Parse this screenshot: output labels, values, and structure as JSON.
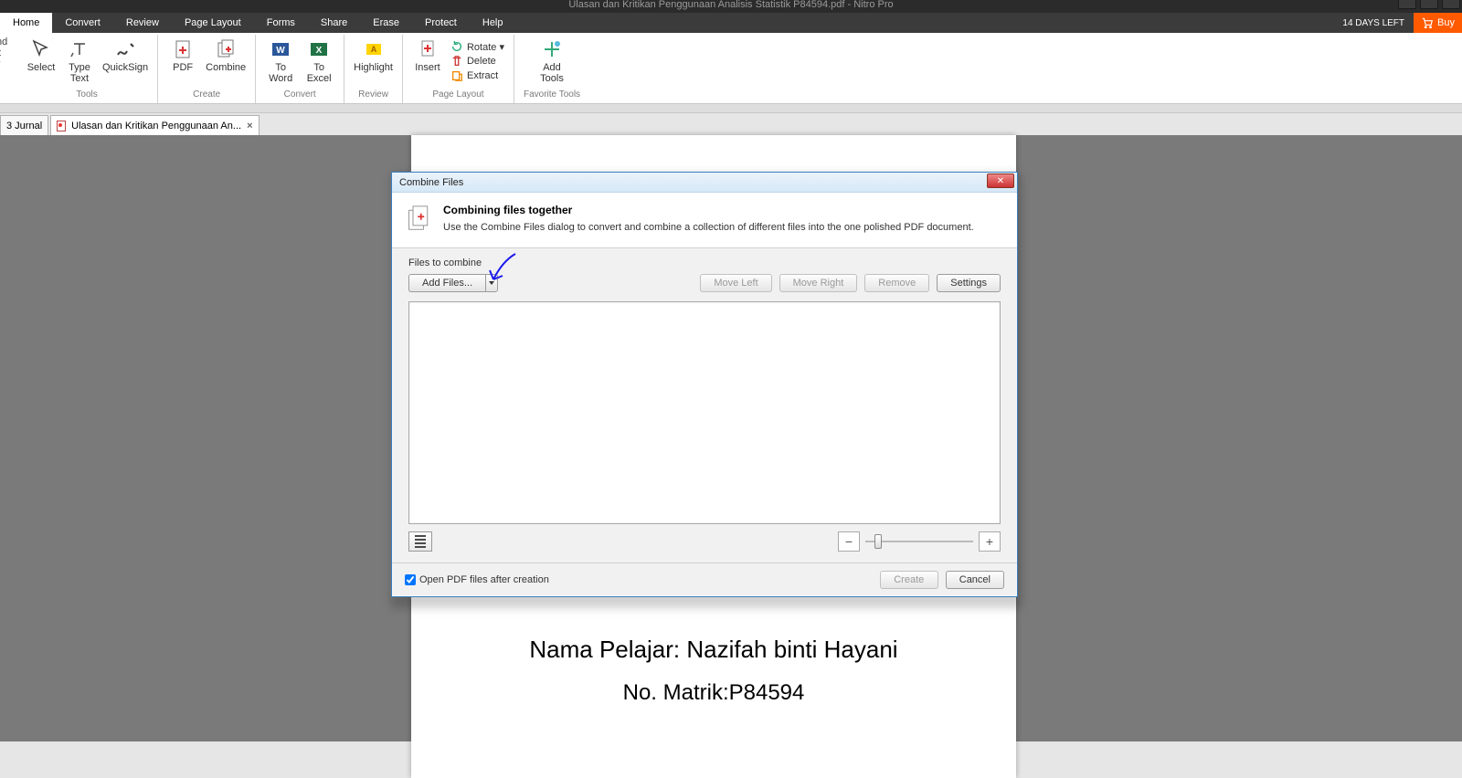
{
  "window": {
    "title": "Ulasan dan Kritikan Penggunaan Analisis Statistik P84594.pdf - Nitro Pro",
    "days_left": "14 DAYS LEFT",
    "buy": "Buy"
  },
  "menu": {
    "tabs": [
      "Home",
      "Convert",
      "Review",
      "Page Layout",
      "Forms",
      "Share",
      "Erase",
      "Protect",
      "Help"
    ]
  },
  "extras": {
    "hand_top": "nd",
    "hand_bottom": "t",
    "hand_arrow": "▾"
  },
  "ribbon": {
    "groups": [
      {
        "label": "Tools",
        "items": [
          {
            "label": "Select",
            "icon": "cursor"
          },
          {
            "label": "Type\nText",
            "icon": "typetext"
          },
          {
            "label": "QuickSign",
            "icon": "quicksign"
          }
        ]
      },
      {
        "label": "Create",
        "items": [
          {
            "label": "PDF",
            "icon": "pdf"
          },
          {
            "label": "Combine",
            "icon": "combine"
          }
        ]
      },
      {
        "label": "Convert",
        "items": [
          {
            "label": "To\nWord",
            "icon": "toword"
          },
          {
            "label": "To\nExcel",
            "icon": "toexcel"
          }
        ]
      },
      {
        "label": "Review",
        "items": [
          {
            "label": "Highlight",
            "icon": "highlight"
          }
        ]
      },
      {
        "label": "Page Layout",
        "insert": {
          "label": "Insert",
          "icon": "insert"
        },
        "rows": [
          {
            "label": "Rotate ▾",
            "icon": "rotate"
          },
          {
            "label": "Delete",
            "icon": "delete"
          },
          {
            "label": "Extract",
            "icon": "extract"
          }
        ]
      },
      {
        "label": "Favorite Tools",
        "items": [
          {
            "label": "Add\nTools",
            "icon": "addtools"
          }
        ]
      }
    ]
  },
  "doctabs": {
    "tabs": [
      {
        "label": "3 Jurnal"
      },
      {
        "label": "Ulasan dan Kritikan Penggunaan An...",
        "active": true
      }
    ]
  },
  "page": {
    "line1": "Nama Pelajar: Nazifah binti Hayani",
    "line2": "No. Matrik:P84594"
  },
  "dialog": {
    "title": "Combine Files",
    "heading": "Combining files together",
    "sub": "Use the Combine Files dialog to convert and combine a collection of different files into the one polished PDF document.",
    "files_label": "Files to combine",
    "add_files": "Add Files...",
    "move_left": "Move Left",
    "move_right": "Move Right",
    "remove": "Remove",
    "settings": "Settings",
    "open_after": "Open PDF files after creation",
    "create": "Create",
    "cancel": "Cancel"
  }
}
